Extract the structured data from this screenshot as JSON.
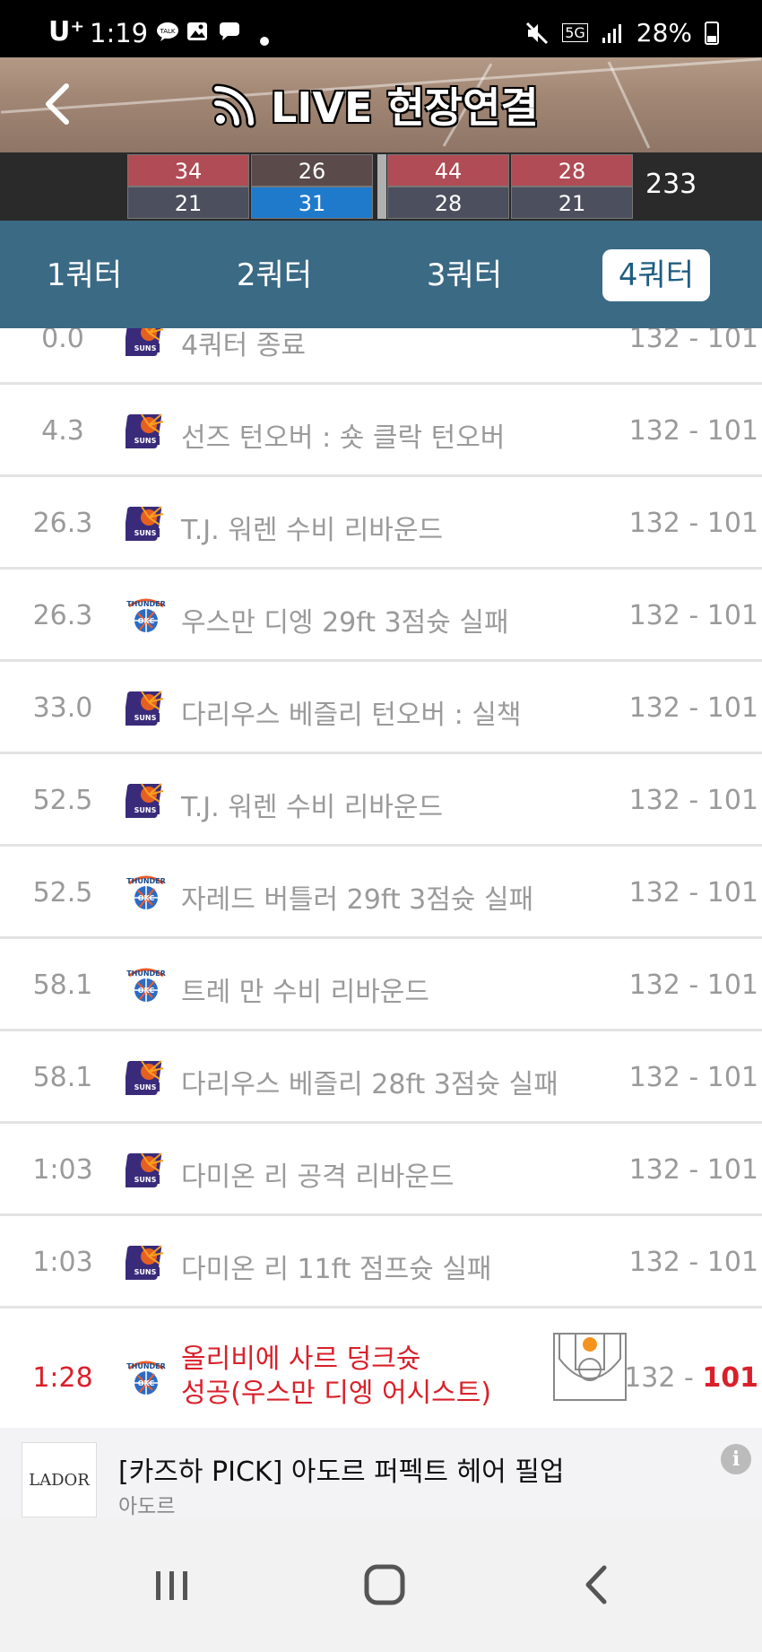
{
  "status_bar": {
    "carrier": "U⁺",
    "time": "1:19",
    "notif_icons": [
      "talk-icon",
      "gallery-icon",
      "message-icon",
      "dot-icon"
    ],
    "network": "5G",
    "battery": "28%"
  },
  "header": {
    "title": "LIVE 현장연결"
  },
  "score_strip": {
    "quarters": [
      {
        "top": "34",
        "bottom": "21",
        "bottom_win": false
      },
      {
        "top": "26",
        "bottom": "31",
        "bottom_win": true
      },
      {
        "top": "44",
        "bottom": "28",
        "bottom_win": false
      },
      {
        "top": "28",
        "bottom": "21",
        "bottom_win": false
      }
    ],
    "total": "233"
  },
  "tabs": [
    {
      "label": "1쿼터",
      "active": false
    },
    {
      "label": "2쿼터",
      "active": false
    },
    {
      "label": "3쿼터",
      "active": false
    },
    {
      "label": "4쿼터",
      "active": true
    }
  ],
  "plays": [
    {
      "time": "0.0",
      "team": "suns",
      "desc": "4쿼터 종료",
      "home": "132",
      "away": "101"
    },
    {
      "time": "4.3",
      "team": "suns",
      "desc": "선즈 턴오버 : 숏 클락 턴오버",
      "home": "132",
      "away": "101"
    },
    {
      "time": "26.3",
      "team": "suns",
      "desc": "T.J. 워렌 수비 리바운드",
      "home": "132",
      "away": "101"
    },
    {
      "time": "26.3",
      "team": "thunder",
      "desc": "우스만 디엥 29ft 3점슛 실패",
      "home": "132",
      "away": "101"
    },
    {
      "time": "33.0",
      "team": "suns",
      "desc": "다리우스 베즐리 턴오버 : 실책",
      "home": "132",
      "away": "101"
    },
    {
      "time": "52.5",
      "team": "suns",
      "desc": "T.J. 워렌 수비 리바운드",
      "home": "132",
      "away": "101"
    },
    {
      "time": "52.5",
      "team": "thunder",
      "desc": "자레드 버틀러 29ft 3점슛 실패",
      "home": "132",
      "away": "101"
    },
    {
      "time": "58.1",
      "team": "thunder",
      "desc": "트레 만 수비 리바운드",
      "home": "132",
      "away": "101"
    },
    {
      "time": "58.1",
      "team": "suns",
      "desc": "다리우스 베즐리 28ft 3점슛 실패",
      "home": "132",
      "away": "101"
    },
    {
      "time": "1:03",
      "team": "suns",
      "desc": "다미온 리 공격 리바운드",
      "home": "132",
      "away": "101"
    },
    {
      "time": "1:03",
      "team": "suns",
      "desc": "다미온 리 11ft 점프슛 실패",
      "home": "132",
      "away": "101"
    },
    {
      "time": "1:28",
      "team": "thunder",
      "desc_line1": "올리비에 사르 덩크슛",
      "desc_line2": "성공(우스만 디엥 어시스트)",
      "home": "132",
      "away": "101",
      "highlight": true
    }
  ],
  "ad": {
    "brand": "LADOR",
    "title": "[카즈하 PICK] 아도르 퍼펙트 헤어 필업",
    "sub": "아도르"
  },
  "score_sep": " - "
}
